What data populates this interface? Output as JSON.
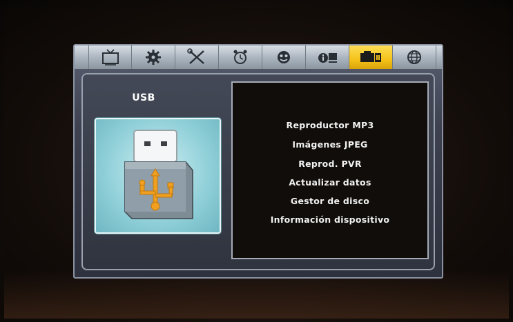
{
  "menu": {
    "tabs": [
      {
        "icon": "tv-icon",
        "active": false
      },
      {
        "icon": "gear-icon",
        "active": false
      },
      {
        "icon": "tools-icon",
        "active": false
      },
      {
        "icon": "alarm-clock-icon",
        "active": false
      },
      {
        "icon": "face-icon",
        "active": false
      },
      {
        "icon": "info-icon",
        "active": false
      },
      {
        "icon": "usb-tab-icon",
        "active": true
      },
      {
        "icon": "globe-icon",
        "active": false
      }
    ],
    "section_title": "USB",
    "items": [
      "Reproductor MP3",
      "Imágenes JPEG",
      "Reprod. PVR",
      "Actualizar datos",
      "Gestor de disco",
      "Información dispositivo"
    ]
  },
  "colors": {
    "active_tab": "#f4c21a",
    "usb_symbol": "#f0a020",
    "preview_bg": "#8fcfd8"
  }
}
